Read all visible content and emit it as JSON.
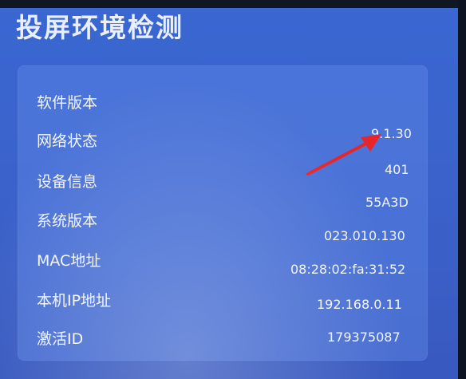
{
  "screen": {
    "title": "投屏环境检测",
    "rows": [
      {
        "label": "软件版本",
        "value": "9.1.30"
      },
      {
        "label": "网络状态",
        "value": "401"
      },
      {
        "label": "设备信息",
        "value": "55A3D"
      },
      {
        "label": "系统版本",
        "value": "023.010.130"
      },
      {
        "label": "MAC地址",
        "value": "08:28:02:fa:31:52"
      },
      {
        "label": "本机IP地址",
        "value": "192.168.0.11"
      },
      {
        "label": "激活ID",
        "value": "179375087"
      }
    ]
  },
  "colors": {
    "background": "#3b63cc",
    "panel": "#5a82de",
    "text": "#f2f5ff",
    "arrow": "#e8262a"
  },
  "icons": [
    "red-arrow-annotation-icon"
  ]
}
